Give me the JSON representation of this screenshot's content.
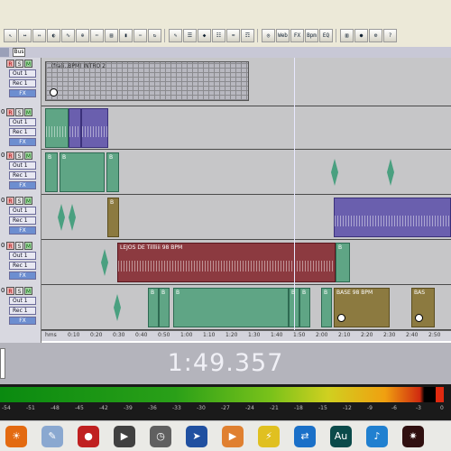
{
  "toolbar": {
    "row1": [],
    "row2": [
      {
        "icon": "select-tool-icon",
        "glyph": "↖"
      },
      {
        "icon": "time-select-icon",
        "glyph": "↔"
      },
      {
        "icon": "hybrid-tool-icon",
        "glyph": "⇔"
      },
      {
        "icon": "scrub-tool-icon",
        "glyph": "◐"
      },
      {
        "icon": "envelope-tool-icon",
        "glyph": "∿"
      },
      {
        "icon": "zoom-tool-icon",
        "glyph": "⊕"
      },
      {
        "icon": "split-tool-icon",
        "glyph": "✂"
      },
      {
        "icon": "group-tool-icon",
        "glyph": "▤"
      },
      {
        "icon": "marker-tool-icon",
        "glyph": "▮"
      },
      {
        "icon": "snap-tool-icon",
        "glyph": "⋯"
      },
      {
        "icon": "loop-tool-icon",
        "glyph": "↻"
      },
      {
        "icon": "edit-tool-icon",
        "glyph": "✎"
      },
      {
        "icon": "view-files-icon",
        "glyph": "☰"
      },
      {
        "icon": "view-effects-icon",
        "glyph": "◆"
      },
      {
        "icon": "view-mixer-icon",
        "glyph": "☷"
      },
      {
        "icon": "view-wave-icon",
        "glyph": "≈"
      },
      {
        "icon": "view-multitrack-icon",
        "glyph": "☶"
      },
      {
        "icon": "view-cd-icon",
        "glyph": "◎"
      },
      {
        "icon": "web-icon",
        "glyph": "Web"
      },
      {
        "icon": "fx-icon",
        "glyph": "FX"
      },
      {
        "icon": "bpm-icon",
        "glyph": "Bpm"
      },
      {
        "icon": "eq-icon",
        "glyph": "EQ"
      },
      {
        "icon": "meter-icon",
        "glyph": "▥"
      },
      {
        "icon": "record-icon",
        "glyph": "●"
      },
      {
        "icon": "settings-icon",
        "glyph": "⚙"
      },
      {
        "icon": "help-icon",
        "glyph": "?"
      }
    ]
  },
  "header": {
    "bus_label": "Bus"
  },
  "track_controls": [
    {
      "num": "",
      "r": "R",
      "s": "S",
      "m": "M",
      "out": "Out 1",
      "rec": "Rec 1",
      "fx": "FX"
    },
    {
      "num": "0",
      "r": "R",
      "s": "S",
      "m": "M",
      "out": "Out 1",
      "rec": "Rec 1",
      "fx": "FX"
    },
    {
      "num": "0",
      "r": "R",
      "s": "S",
      "m": "M",
      "out": "Out 1",
      "rec": "Rec 1",
      "fx": "FX"
    },
    {
      "num": "0",
      "r": "R",
      "s": "S",
      "m": "M",
      "out": "Out 1",
      "rec": "Rec 1",
      "fx": "FX"
    },
    {
      "num": "0",
      "r": "R",
      "s": "S",
      "m": "M",
      "out": "Out 1",
      "rec": "Rec 1",
      "fx": "FX"
    },
    {
      "num": "0",
      "r": "R",
      "s": "S",
      "m": "M",
      "out": "Out 1",
      "rec": "Rec 1",
      "fx": "FX"
    }
  ],
  "clips": {
    "intro": "..(fra(i..BPM) INTRO 2",
    "lejos": "LEJOS DE Tillliii 98 BPM",
    "base1": "BASE 98 BPM",
    "base2": "BAS",
    "b": "B"
  },
  "ruler": {
    "ticks": [
      "hms",
      "0:10",
      "0:20",
      "0:30",
      "0:40",
      "0:50",
      "1:00",
      "1:10",
      "1:20",
      "1:30",
      "1:40",
      "1:50",
      "2:00",
      "2:10",
      "2:20",
      "2:30",
      "2:40",
      "2:50"
    ]
  },
  "counter": {
    "time": "1:49.357"
  },
  "meter": {
    "level": 0.97,
    "ticks": [
      "-54",
      "-51",
      "-48",
      "-45",
      "-42",
      "-39",
      "-36",
      "-33",
      "-30",
      "-27",
      "-24",
      "-21",
      "-18",
      "-15",
      "-12",
      "-9",
      "-6",
      "-3",
      "0"
    ]
  },
  "colors": {
    "green_clip": "#5fa585",
    "purple_clip": "#6a5fae",
    "red_clip": "#8c3a40",
    "olive_clip": "#8c7a40"
  },
  "taskbar": [
    {
      "icon": "firefox-icon",
      "glyph": "☀",
      "color": "#e36a10"
    },
    {
      "icon": "notepad-icon",
      "glyph": "✎",
      "color": "#8aa8d0"
    },
    {
      "icon": "red-app-icon",
      "glyph": "●",
      "color": "#c02020"
    },
    {
      "icon": "media-player-icon",
      "glyph": "▶",
      "color": "#404040"
    },
    {
      "icon": "clock-icon",
      "glyph": "◷",
      "color": "#606060"
    },
    {
      "icon": "arrow-app-icon",
      "glyph": "➤",
      "color": "#2050a0"
    },
    {
      "icon": "video-icon",
      "glyph": "▶",
      "color": "#e08030"
    },
    {
      "icon": "winamp-icon",
      "glyph": "⚡",
      "color": "#e0c020"
    },
    {
      "icon": "teamviewer-icon",
      "glyph": "⇄",
      "color": "#1a70c8"
    },
    {
      "icon": "audition-icon",
      "glyph": "Au",
      "color": "#0a4a4a"
    },
    {
      "icon": "itunes-icon",
      "glyph": "♪",
      "color": "#2080d0"
    },
    {
      "icon": "flame-icon",
      "glyph": "✷",
      "color": "#301010"
    }
  ]
}
